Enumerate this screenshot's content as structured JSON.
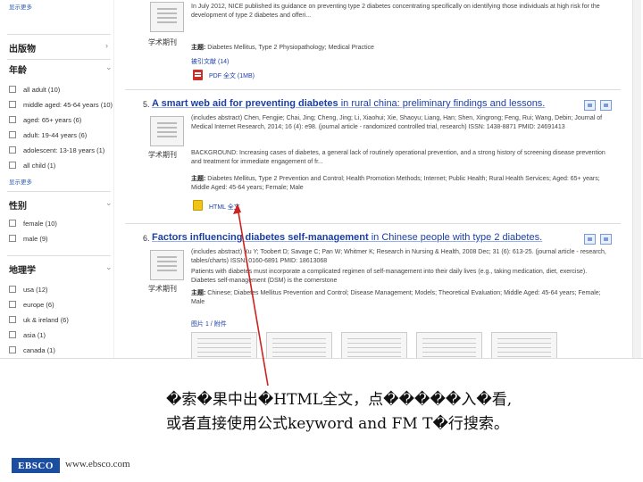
{
  "sidebar": {
    "top_link": "显示更多",
    "facets": [
      {
        "heading": "出版物"
      },
      {
        "heading": "年龄",
        "options": [
          {
            "label": "all adult (10)"
          },
          {
            "label": "middle aged: 45-64 years (10)"
          },
          {
            "label": "aged: 65+ years (6)"
          },
          {
            "label": "adult: 19-44 years (6)"
          },
          {
            "label": "adolescent: 13-18 years (1)"
          },
          {
            "label": "all child (1)"
          }
        ],
        "more_link": "显示更多"
      },
      {
        "heading": "性别",
        "options": [
          {
            "label": "female (10)"
          },
          {
            "label": "male (9)"
          }
        ]
      },
      {
        "heading": "地理学",
        "options": [
          {
            "label": "usa (12)"
          },
          {
            "label": "europe (6)"
          },
          {
            "label": "uk & ireland (6)"
          },
          {
            "label": "asia (1)"
          },
          {
            "label": "canada (1)"
          }
        ]
      }
    ]
  },
  "results": [
    {
      "text": "In July 2012, NICE published its guidance on preventing type 2 diabetes concentrating specifically on identifying those individuals at high risk for the development of type 2 diabetes and offeri...",
      "pub_type": "学术期刊",
      "subjects_label": "主题:",
      "subjects": "Diabetes Mellitus, Type 2 Physiopathology; Medical Practice",
      "cited_link": "被引文献 (14)",
      "format_link": "PDF 全文 (1MB)"
    },
    {
      "number": "5.",
      "title_hl": "A smart web aid for preventing diabetes",
      "title_rest": " in rural china: preliminary findings and lessons.",
      "pub_type": "学术期刊",
      "authors_source": "(includes abstract) Chen, Fengjie; Chai, Jing; Cheng, Jing; Li, Xiaohui; Xie, Shaoyu; Liang, Han; Shen, Xingrong; Feng, Rui; Wang, Debin; Journal of Medical Internet Research, 2014; 16 (4): e98. (journal article - randomized controlled trial, research) ISSN: 1438-8871 PMID: 24691413",
      "abstract": "BACKGROUND: Increasing cases of diabetes, a general lack of routinely operational prevention, and a strong history of screening disease prevention and treatment for immediate engagement of fr...",
      "subjects_label": "主题:",
      "subjects": "Diabetes Mellitus, Type 2 Prevention and Control; Health Promotion Methods; Internet; Public Health; Rural Health Services; Aged: 65+ years; Middle Aged: 45-64 years; Female; Male",
      "format_link": "HTML 全文"
    },
    {
      "number": "6.",
      "title_hl": "Factors influencing diabetes self-management",
      "title_rest": " in Chinese people with type 2 diabetes.",
      "pub_type": "学术期刊",
      "authors_source": "(includes abstract) Xu Y; Toobert D; Savage C; Pan W; Whitmer K; Research in Nursing & Health, 2008 Dec; 31 (6): 613-25. (journal article - research, tables/charts) ISSN: 0160-6891 PMID: 18613068",
      "abstract": "Patients with diabetes must incorporate a complicated regimen of self-management into their daily lives (e.g., taking medication, diet, exercise). Diabetes self-management (DSM) is the cornerstone",
      "subjects_label": "主题:",
      "subjects": "Chinese; Diabetes Mellitus Prevention and Control; Disease Management; Models; Theoretical Evaluation; Middle Aged: 45-64 years; Female; Male",
      "images_link": "图片 1 / 附件"
    }
  ],
  "annotation": {
    "line1": "�索�果中出�HTML全文，点�����入�看,",
    "line2": "或者直接使用公式keyword and FM T�行搜索。",
    "arrow_color": "#cc2222"
  },
  "footer": {
    "logo_text": "EBSCO",
    "url": "www.ebsco.com",
    "logo_color": "#1b4ea0"
  }
}
